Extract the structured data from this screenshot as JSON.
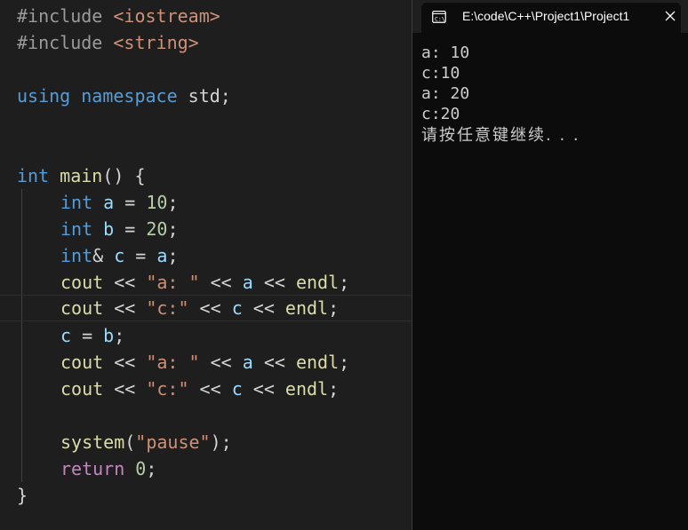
{
  "editor": {
    "lines": [
      [
        {
          "t": "#include ",
          "c": "pp"
        },
        {
          "t": "<iostream>",
          "c": "inc"
        }
      ],
      [
        {
          "t": "#include ",
          "c": "pp"
        },
        {
          "t": "<string>",
          "c": "inc"
        }
      ],
      [],
      [
        {
          "t": "using",
          "c": "kw"
        },
        {
          "t": " ",
          "c": "op"
        },
        {
          "t": "namespace",
          "c": "kw"
        },
        {
          "t": " std;",
          "c": "op"
        }
      ],
      [],
      [],
      [
        {
          "t": "int",
          "c": "kw"
        },
        {
          "t": " ",
          "c": "op"
        },
        {
          "t": "main",
          "c": "fn"
        },
        {
          "t": "() {",
          "c": "br"
        }
      ],
      [
        {
          "t": "int",
          "c": "kw"
        },
        {
          "t": " ",
          "c": "op"
        },
        {
          "t": "a",
          "c": "var"
        },
        {
          "t": " = ",
          "c": "op"
        },
        {
          "t": "10",
          "c": "num"
        },
        {
          "t": ";",
          "c": "op"
        }
      ],
      [
        {
          "t": "int",
          "c": "kw"
        },
        {
          "t": " ",
          "c": "op"
        },
        {
          "t": "b",
          "c": "var"
        },
        {
          "t": " = ",
          "c": "op"
        },
        {
          "t": "20",
          "c": "num"
        },
        {
          "t": ";",
          "c": "op"
        }
      ],
      [
        {
          "t": "int",
          "c": "kw"
        },
        {
          "t": "& ",
          "c": "op"
        },
        {
          "t": "c",
          "c": "var"
        },
        {
          "t": " = ",
          "c": "op"
        },
        {
          "t": "a",
          "c": "var"
        },
        {
          "t": ";",
          "c": "op"
        }
      ],
      [
        {
          "t": "cout",
          "c": "fn"
        },
        {
          "t": " << ",
          "c": "op"
        },
        {
          "t": "\"a: \"",
          "c": "str"
        },
        {
          "t": " << ",
          "c": "op"
        },
        {
          "t": "a",
          "c": "var"
        },
        {
          "t": " << ",
          "c": "op"
        },
        {
          "t": "endl",
          "c": "fn"
        },
        {
          "t": ";",
          "c": "op"
        }
      ],
      [
        {
          "t": "cout",
          "c": "fn"
        },
        {
          "t": " << ",
          "c": "op"
        },
        {
          "t": "\"c:\"",
          "c": "str"
        },
        {
          "t": " << ",
          "c": "op"
        },
        {
          "t": "c",
          "c": "var"
        },
        {
          "t": " << ",
          "c": "op"
        },
        {
          "t": "endl",
          "c": "fn"
        },
        {
          "t": ";",
          "c": "op"
        }
      ],
      [
        {
          "t": "c",
          "c": "var"
        },
        {
          "t": " = ",
          "c": "op"
        },
        {
          "t": "b",
          "c": "var"
        },
        {
          "t": ";",
          "c": "op"
        }
      ],
      [
        {
          "t": "cout",
          "c": "fn"
        },
        {
          "t": " << ",
          "c": "op"
        },
        {
          "t": "\"a: \"",
          "c": "str"
        },
        {
          "t": " << ",
          "c": "op"
        },
        {
          "t": "a",
          "c": "var"
        },
        {
          "t": " << ",
          "c": "op"
        },
        {
          "t": "endl",
          "c": "fn"
        },
        {
          "t": ";",
          "c": "op"
        }
      ],
      [
        {
          "t": "cout",
          "c": "fn"
        },
        {
          "t": " << ",
          "c": "op"
        },
        {
          "t": "\"c:\"",
          "c": "str"
        },
        {
          "t": " << ",
          "c": "op"
        },
        {
          "t": "c",
          "c": "var"
        },
        {
          "t": " << ",
          "c": "op"
        },
        {
          "t": "endl",
          "c": "fn"
        },
        {
          "t": ";",
          "c": "op"
        }
      ],
      [],
      [
        {
          "t": "system",
          "c": "fn"
        },
        {
          "t": "(",
          "c": "op"
        },
        {
          "t": "\"pause\"",
          "c": "str"
        },
        {
          "t": ");",
          "c": "op"
        }
      ],
      [
        {
          "t": "return",
          "c": "ctl"
        },
        {
          "t": " ",
          "c": "op"
        },
        {
          "t": "0",
          "c": "num"
        },
        {
          "t": ";",
          "c": "op"
        }
      ],
      [
        {
          "t": "}",
          "c": "br"
        }
      ]
    ]
  },
  "console": {
    "tab_title": "E:\\code\\C++\\Project1\\Project1",
    "terminal_icon": "terminal-icon",
    "close_icon": "close-icon",
    "output": [
      "a: 10",
      "c:10",
      "a: 20",
      "c:20",
      "请按任意键继续. . ."
    ]
  },
  "colors": {
    "editor_bg": "#1e1e1e",
    "console_bg": "#0c0c0c",
    "keyword": "#569cd6",
    "function": "#dcdcaa",
    "variable": "#9cdcfe",
    "number": "#b5cea8",
    "string": "#ce9178",
    "control": "#c586c0"
  }
}
